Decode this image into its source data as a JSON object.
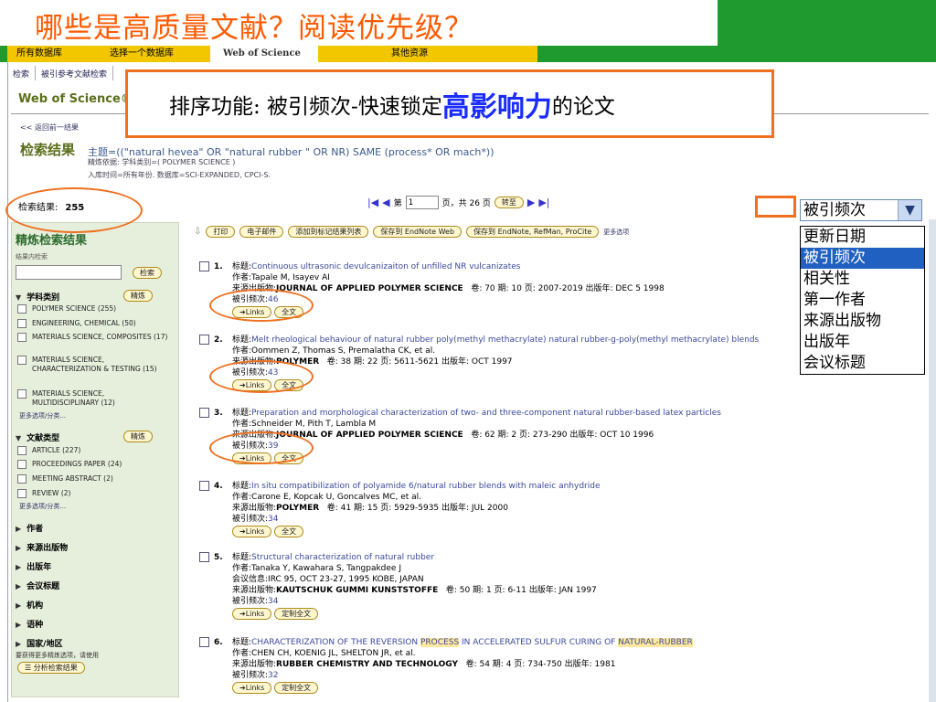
{
  "slide": {
    "title": "哪些是高质量文献？阅读优先级？"
  },
  "tabs": [
    "所有数据库",
    "选择一个数据库",
    "Web of Science",
    "其他资源"
  ],
  "subnav": [
    "检索",
    "被引参考文献检索"
  ],
  "product": "Web of Science®",
  "callout": {
    "prefix": "排序功能: 被引频次-快速锁定",
    "highlight": "高影响力",
    "suffix": "的论文"
  },
  "back_link": "<< 返回前一结果",
  "results_header": {
    "title": "检索结果",
    "query": "主题=((\"natural hevea\" OR \"natural rubber \" OR NR) SAME (process* OR mach*))",
    "refine": "精炼依据: 学科类别=( POLYMER SCIENCE )",
    "timespan": "入库时间=所有年份. 数据库=SCI-EXPANDED, CPCI-S."
  },
  "count": {
    "label": "检索结果:",
    "value": "255"
  },
  "pager": {
    "page_prefix": "第",
    "page_value": "1",
    "page_suffix": "页，共 26 页",
    "go": "转至"
  },
  "sort": {
    "selected": "被引频次",
    "options": [
      "更新日期",
      "被引频次",
      "相关性",
      "第一作者",
      "来源出版物",
      "出版年",
      "会议标题"
    ]
  },
  "toolbar": {
    "print": "打印",
    "email": "电子邮件",
    "add_marked": "添加到标记结果列表",
    "save_endnote_web": "保存到 EndNote Web",
    "save_endnote": "保存到 EndNote, RefMan, ProCite",
    "more": "更多选项"
  },
  "sidebar": {
    "title": "精炼检索结果",
    "search_within": "结果内检索",
    "search_btn": "检索",
    "refine_btn": "精炼",
    "subject": {
      "label": "学科类别",
      "items": [
        "POLYMER SCIENCE (255)",
        "ENGINEERING, CHEMICAL (50)",
        "MATERIALS SCIENCE, COMPOSITES (17)",
        "MATERIALS SCIENCE, CHARACTERIZATION & TESTING (15)",
        "MATERIALS SCIENCE, MULTIDISCIPLINARY (12)"
      ]
    },
    "more_options": "更多选项/分类...",
    "doctype": {
      "label": "文献类型",
      "items": [
        "ARTICLE (227)",
        "PROCEEDINGS PAPER (24)",
        "MEETING ABSTRACT (2)",
        "REVIEW (2)"
      ]
    },
    "collapsed": [
      "作者",
      "来源出版物",
      "出版年",
      "会议标题",
      "机构",
      "语种",
      "国家/地区"
    ],
    "note": "要获得更多精炼选项，请使用",
    "analyze": "分析检索结果"
  },
  "labels": {
    "title": "标题:",
    "author": "作者:",
    "source": "来源出版物:",
    "cited": "被引频次:",
    "links": "Links",
    "fulltext": "全文",
    "custom": "定制全文",
    "conf": "会议信息:"
  },
  "results": [
    {
      "n": "1.",
      "title": "Continuous ultrasonic devulcanizaiton of unfilled NR vulcanizates",
      "authors": "Tapale M, Isayev AI",
      "source": "JOURNAL OF APPLIED POLYMER SCIENCE",
      "details": "卷: 70   期: 10   页: 2007-2019   出版年: DEC 5 1998",
      "cited": "46",
      "btn": "全文"
    },
    {
      "n": "2.",
      "title": "Melt rheological behaviour of natural rubber poly(methyl methacrylate) natural rubber-g-poly(methyl methacrylate) blends",
      "authors": "Oommen Z, Thomas S, Premalatha CK, et al.",
      "source": "POLYMER",
      "details": "卷: 38   期: 22   页: 5611-5621   出版年: OCT 1997",
      "cited": "43",
      "btn": "全文"
    },
    {
      "n": "3.",
      "title": "Preparation and morphological characterization of two- and three-component natural rubber-based latex particles",
      "authors": "Schneider M, Pith T, Lambla M",
      "source": "JOURNAL OF APPLIED POLYMER SCIENCE",
      "details": "卷: 62   期: 2   页: 273-290   出版年: OCT 10 1996",
      "cited": "39",
      "btn": "全文"
    },
    {
      "n": "4.",
      "title": "In situ compatibilization of polyamide 6/natural rubber blends with maleic anhydride",
      "authors": "Carone E, Kopcak U, Goncalves MC, et al.",
      "source": "POLYMER",
      "details": "卷: 41   期: 15   页: 5929-5935   出版年: JUL 2000",
      "cited": "34",
      "btn": "全文"
    },
    {
      "n": "5.",
      "title": "Structural characterization of natural rubber",
      "authors": "Tanaka Y, Kawahara S, Tangpakdee J",
      "conf": "IRC 95, OCT 23-27, 1995 KOBE, JAPAN",
      "source": "KAUTSCHUK GUMMI KUNSTSTOFFE",
      "details": "卷: 50   期: 1   页: 6-11   出版年: JAN 1997",
      "cited": "34",
      "btn": "定制全文"
    },
    {
      "n": "6.",
      "title_a": "CHARACTERIZATION OF THE REVERSION ",
      "title_hl1": "PROCESS",
      "title_b": " IN ACCELERATED SULFUR CURING OF ",
      "title_hl2": "NATURAL-RUBBER",
      "authors": "CHEN CH, KOENIG JL, SHELTON JR, et al.",
      "source": "RUBBER CHEMISTRY AND TECHNOLOGY",
      "details": "卷: 54   期: 4   页: 734-750   出版年: 1981",
      "cited": "32",
      "btn": "定制全文"
    }
  ]
}
